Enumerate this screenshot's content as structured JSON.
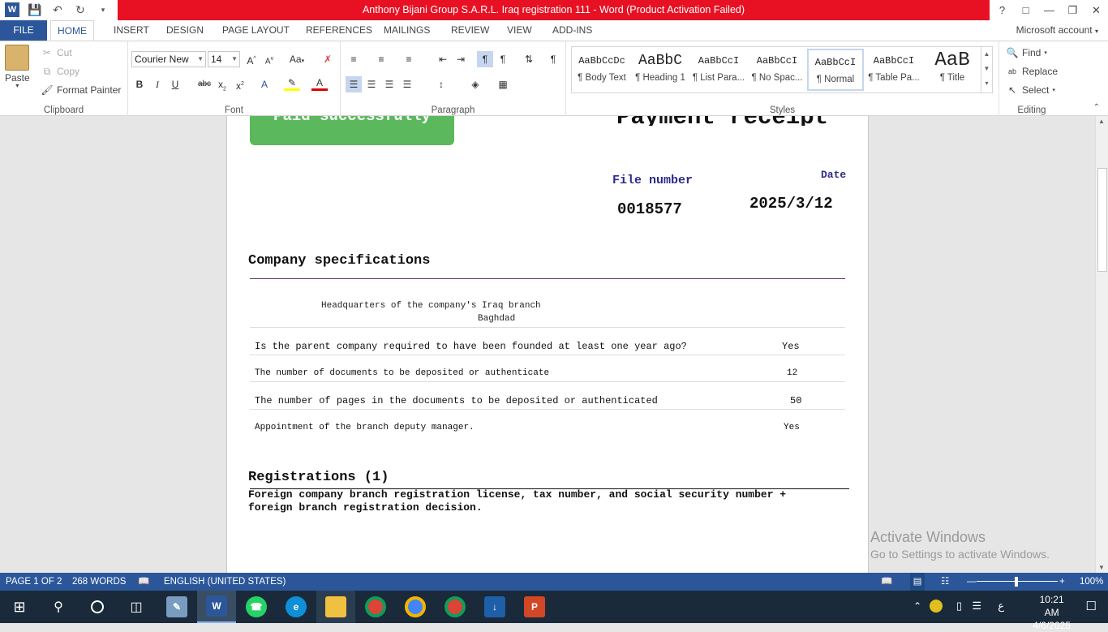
{
  "window": {
    "title": "Anthony Bijani Group S.A.R.L. Iraq registration  111 -  Word (Product Activation Failed)",
    "help": "?"
  },
  "tabs": [
    "FILE",
    "HOME",
    "INSERT",
    "DESIGN",
    "PAGE LAYOUT",
    "REFERENCES",
    "MAILINGS",
    "REVIEW",
    "VIEW",
    "ADD-INS"
  ],
  "account": "Microsoft account",
  "ribbon": {
    "clipboard": {
      "paste": "Paste",
      "cut": "Cut",
      "copy": "Copy",
      "format_painter": "Format Painter",
      "label": "Clipboard"
    },
    "font": {
      "name": "Courier New",
      "size": "14",
      "label": "Font",
      "case": "Aa"
    },
    "paragraph": {
      "label": "Paragraph"
    },
    "styles": {
      "label": "Styles",
      "items": [
        {
          "preview": "AaBbCcDc",
          "name": "¶ Body Text"
        },
        {
          "preview": "AaBbC",
          "name": "¶ Heading 1"
        },
        {
          "preview": "AaBbCcI",
          "name": "¶ List Para..."
        },
        {
          "preview": "AaBbCcI",
          "name": "¶ No Spac..."
        },
        {
          "preview": "AaBbCcI",
          "name": "¶ Normal"
        },
        {
          "preview": "AaBbCcI",
          "name": "¶ Table Pa..."
        },
        {
          "preview": "AaB",
          "name": "¶ Title"
        }
      ]
    },
    "editing": {
      "find": "Find",
      "replace": "Replace",
      "select": "Select",
      "label": "Editing"
    }
  },
  "document": {
    "green_banner": "Paid successfully",
    "receipt_title": "Payment receipt",
    "file_number_label": "File number",
    "file_number": "0018577",
    "date_label": "Date",
    "date": "2025/3/12",
    "section_company": "Company specifications",
    "hq_line1": "Headquarters of the company's Iraq branch",
    "hq_line2": "Baghdad",
    "rows": [
      {
        "q": "Is the parent company required to have been founded at least one year ago?",
        "a": "Yes"
      },
      {
        "q": "The number of documents to be deposited or authenticate",
        "a": "12"
      },
      {
        "q": "The number of pages in the documents to be deposited or authenticated",
        "a": "50"
      },
      {
        "q": "Appointment of the branch deputy manager.",
        "a": "Yes"
      }
    ],
    "section_registrations": "Registrations (1)",
    "registration_text_1": "Foreign company branch registration license, tax number, and social security number +",
    "registration_text_2": "foreign branch registration decision."
  },
  "watermark": {
    "line1": "Activate Windows",
    "line2": "Go to Settings to activate Windows."
  },
  "status": {
    "page": "PAGE 1 OF 2",
    "words": "268 WORDS",
    "language": "ENGLISH (UNITED STATES)",
    "zoom": "100%"
  },
  "taskbar": {
    "time": "10:21 AM",
    "date": "4/6/2025",
    "lang": "ع"
  }
}
